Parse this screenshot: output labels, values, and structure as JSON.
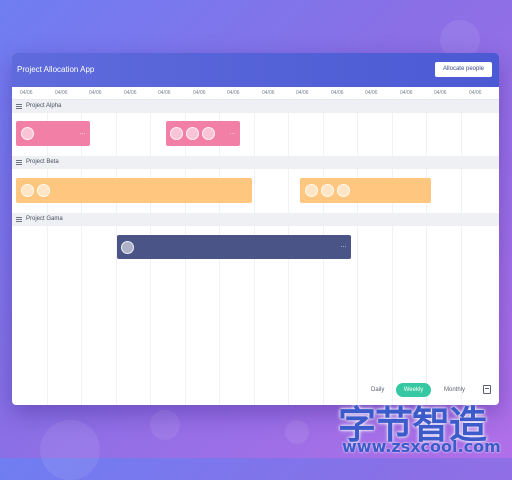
{
  "app": {
    "title": "Project Allocation App",
    "allocate_button": "Allocate people"
  },
  "timeline": {
    "dates": [
      "04/06",
      "04/06",
      "04/06",
      "04/06",
      "04/06",
      "04/06",
      "04/06",
      "04/06",
      "04/06",
      "04/06",
      "04/06",
      "04/06",
      "04/06",
      "04/06"
    ]
  },
  "projects": [
    {
      "name": "Project Alpha"
    },
    {
      "name": "Project Beta"
    },
    {
      "name": "Project Gama"
    }
  ],
  "bars": {
    "more_label": "..."
  },
  "view": {
    "options": [
      "Daily",
      "Weekly",
      "Monthly"
    ],
    "selected": "Weekly"
  },
  "colors": {
    "alpha": "#f27fa5",
    "beta": "#fec67e",
    "gama": "#4b5486",
    "active_view": "#36c8a2"
  },
  "watermark": {
    "title": "字节智造",
    "url": "www.zsxcool.com"
  }
}
